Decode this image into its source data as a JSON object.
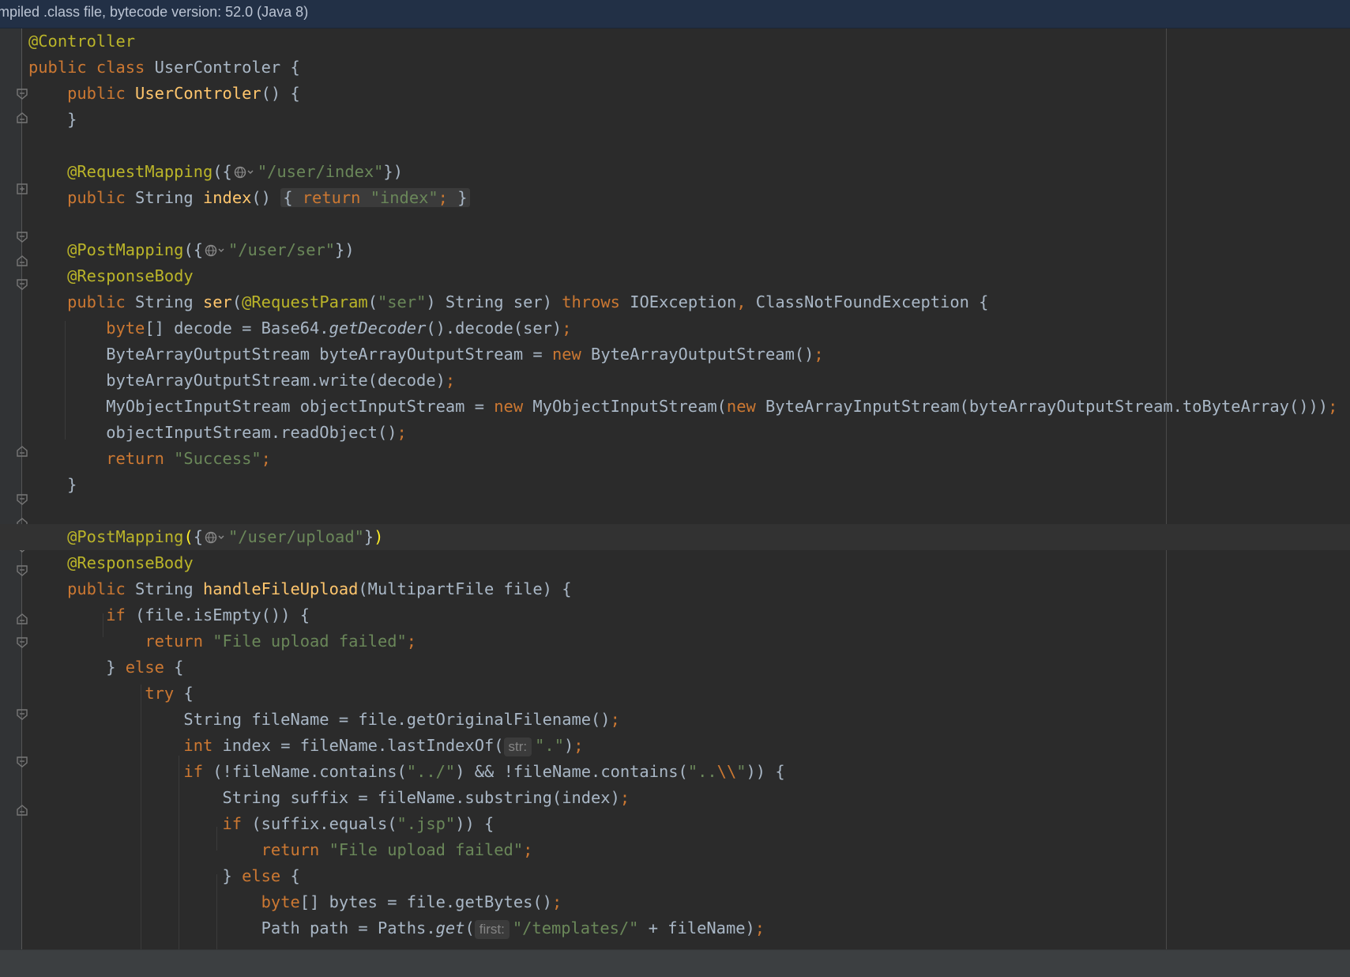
{
  "banner": {
    "text": "mpiled .class file, bytecode version: 52.0 (Java 8)"
  },
  "code": {
    "l1_ann": "@Controller",
    "l2_kw": "public class ",
    "l2_cls": "UserControler {",
    "l3_kw": "public ",
    "l3_fn": "UserControler",
    "l3_rest": "() {",
    "l4": "}",
    "l6_ann": "@RequestMapping",
    "l6_open": "({",
    "l6_str": "\"/user/index\"",
    "l6_close": "})",
    "l7_kw": "public ",
    "l7_type": "String ",
    "l7_fn": "index",
    "l7_paren": "() ",
    "l7_ob": "{ ",
    "l7_ret": "return ",
    "l7_str": "\"index\"",
    "l7_semi": ";",
    "l7_cb": " }",
    "l9_ann": "@PostMapping",
    "l9_open": "({",
    "l9_str": "\"/user/ser\"",
    "l9_close": "})",
    "l10_ann": "@ResponseBody",
    "l11_kw": "public ",
    "l11_type": "String ",
    "l11_fn": "ser",
    "l11_p1": "(",
    "l11_ann": "@RequestParam",
    "l11_p2": "(",
    "l11_str": "\"ser\"",
    "l11_p3": ") String ser) ",
    "l11_kw2": "throws ",
    "l11_ex1": "IOException",
    "l11_comma": ", ",
    "l11_ex2": "ClassNotFoundException {",
    "l12_kw": "byte",
    "l12_a": "[] decode = Base64.",
    "l12_it": "getDecoder",
    "l12_b": "().decode(ser)",
    "l12_semi": ";",
    "l13_a": "ByteArrayOutputStream byteArrayOutputStream = ",
    "l13_kw": "new ",
    "l13_b": "ByteArrayOutputStream()",
    "l13_semi": ";",
    "l14_a": "byteArrayOutputStream.write(decode)",
    "l14_semi": ";",
    "l15_a": "MyObjectInputStream objectInputStream = ",
    "l15_kw": "new ",
    "l15_b": "MyObjectInputStream(",
    "l15_kw2": "new ",
    "l15_c": "ByteArrayInputStream(byteArrayOutputStream.toByteArray()))",
    "l15_semi": ";",
    "l16_a": "objectInputStream.readObject()",
    "l16_semi": ";",
    "l17_kw": "return ",
    "l17_str": "\"Success\"",
    "l17_semi": ";",
    "l18": "}",
    "l20_ann": "@PostMapping",
    "l20_open": "(",
    "l20_br": "{",
    "l20_str": "\"/user/upload\"",
    "l20_cb": "}",
    "l20_close": ")",
    "l21_ann": "@ResponseBody",
    "l22_kw": "public ",
    "l22_type": "String ",
    "l22_fn": "handleFileUpload",
    "l22_rest": "(MultipartFile file) {",
    "l23_kw": "if ",
    "l23_rest": "(file.isEmpty()) {",
    "l24_kw": "return ",
    "l24_str": "\"File upload failed\"",
    "l24_semi": ";",
    "l25_a": "} ",
    "l25_kw": "else ",
    "l25_b": "{",
    "l26_kw": "try ",
    "l26_b": "{",
    "l27_a": "String fileName = file.getOriginalFilename()",
    "l27_semi": ";",
    "l28_kw": "int ",
    "l28_a": "index = fileName.lastIndexOf(",
    "l28_hint": "str:",
    "l28_str": "\".\"",
    "l28_b": ")",
    "l28_semi": ";",
    "l29_kw": "if ",
    "l29_a": "(!fileName.contains(",
    "l29_str1": "\"../\"",
    "l29_b": ") && !fileName.contains(",
    "l29_str2": "\"..",
    "l29_esc": "\\\\",
    "l29_str3": "\"",
    "l29_c": ")) {",
    "l30_a": "String suffix = fileName.substring(index)",
    "l30_semi": ";",
    "l31_kw": "if ",
    "l31_a": "(suffix.equals(",
    "l31_str": "\".jsp\"",
    "l31_b": ")) {",
    "l32_kw": "return ",
    "l32_str": "\"File upload failed\"",
    "l32_semi": ";",
    "l33_a": "} ",
    "l33_kw": "else ",
    "l33_b": "{",
    "l34_kw": "byte",
    "l34_a": "[] bytes = file.getBytes()",
    "l34_semi": ";",
    "l35_a": "Path path = Paths.",
    "l35_it": "get",
    "l35_b": "(",
    "l35_hint": "first:",
    "l35_str": "\"/templates/\"",
    "l35_c": " + fileName)",
    "l35_semi": ";"
  },
  "icons": {
    "fold_start": "fold-start-icon",
    "fold_end": "fold-end-icon",
    "fold_collapsed": "fold-collapsed-icon",
    "url_globe": "globe-icon"
  },
  "colors": {
    "background": "#2b2b2b",
    "keyword": "#cc7832",
    "annotation": "#bbb529",
    "string": "#6a8759",
    "function": "#ffc66d",
    "plain": "#a9b7c6"
  }
}
